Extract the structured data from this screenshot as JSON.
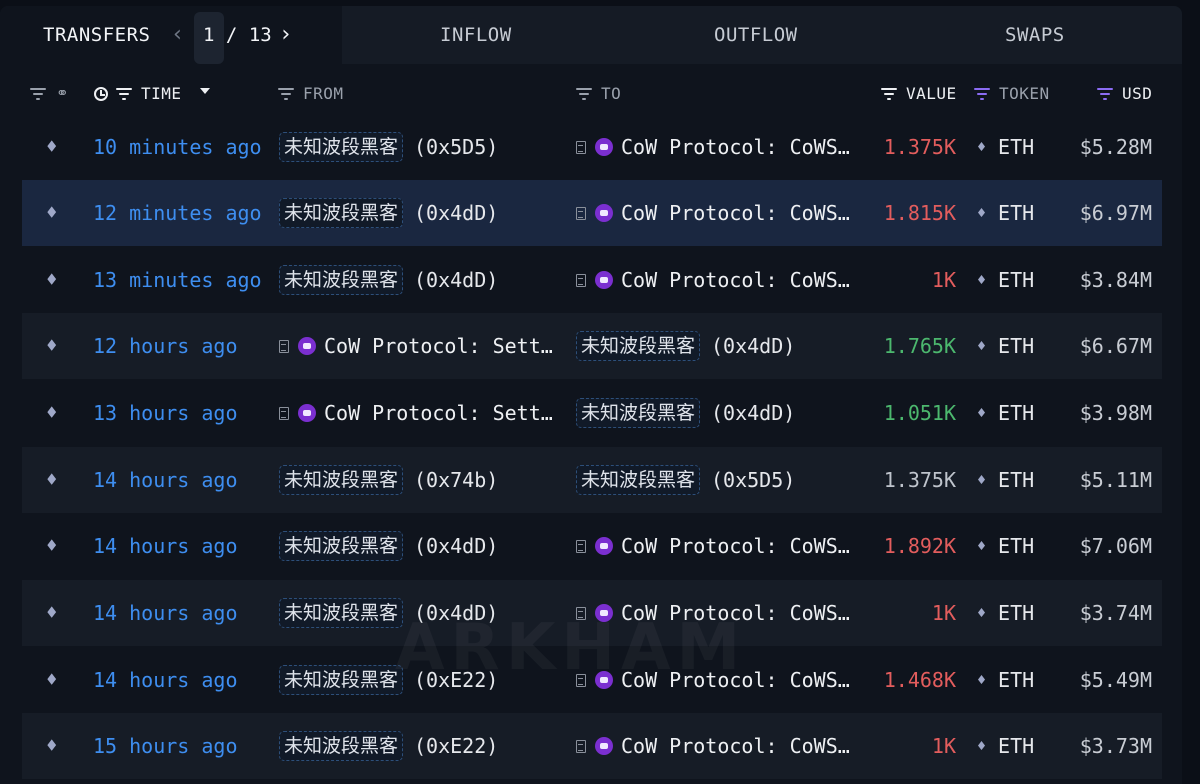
{
  "header": {
    "title": "TRANSFERS",
    "pager": {
      "current": "1",
      "separator": "/",
      "total": "13"
    },
    "tabs": [
      "INFLOW",
      "OUTFLOW",
      "SWAPS"
    ]
  },
  "columns": {
    "time": "TIME",
    "from": "FROM",
    "to": "TO",
    "value": "VALUE",
    "token": "TOKEN",
    "usd": "USD"
  },
  "colors": {
    "accent_blue": "#3e8ef0",
    "value_out": "#e35d5d",
    "value_in": "#4cb86e",
    "value_neutral": "#bfc4cc",
    "filter_active": "#8b6cf3"
  },
  "rows": [
    {
      "time": "10 minutes ago",
      "from": {
        "label": "未知波段黑客",
        "addr": "(0x5D5)"
      },
      "to": {
        "label": "CoW Protocol: CoWS…"
      },
      "value": "1.375K",
      "value_color": "red",
      "token": "ETH",
      "usd": "$5.28M"
    },
    {
      "time": "12 minutes ago",
      "from": {
        "label": "未知波段黑客",
        "addr": "(0x4dD)"
      },
      "to": {
        "label": "CoW Protocol: CoWS…"
      },
      "value": "1.815K",
      "value_color": "red",
      "token": "ETH",
      "usd": "$6.97M"
    },
    {
      "time": "13 minutes ago",
      "from": {
        "label": "未知波段黑客",
        "addr": "(0x4dD)"
      },
      "to": {
        "label": "CoW Protocol: CoWS…"
      },
      "value": "1K",
      "value_color": "red",
      "token": "ETH",
      "usd": "$3.84M"
    },
    {
      "time": "12 hours ago",
      "from": {
        "label": "CoW Protocol: Sett…"
      },
      "to": {
        "label": "未知波段黑客",
        "addr": "(0x4dD)"
      },
      "value": "1.765K",
      "value_color": "green",
      "token": "ETH",
      "usd": "$6.67M"
    },
    {
      "time": "13 hours ago",
      "from": {
        "label": "CoW Protocol: Sett…"
      },
      "to": {
        "label": "未知波段黑客",
        "addr": "(0x4dD)"
      },
      "value": "1.051K",
      "value_color": "green",
      "token": "ETH",
      "usd": "$3.98M"
    },
    {
      "time": "14 hours ago",
      "from": {
        "label": "未知波段黑客",
        "addr": "(0x74b)"
      },
      "to": {
        "label": "未知波段黑客",
        "addr": "(0x5D5)"
      },
      "value": "1.375K",
      "value_color": "grey",
      "token": "ETH",
      "usd": "$5.11M"
    },
    {
      "time": "14 hours ago",
      "from": {
        "label": "未知波段黑客",
        "addr": "(0x4dD)"
      },
      "to": {
        "label": "CoW Protocol: CoWS…"
      },
      "value": "1.892K",
      "value_color": "red",
      "token": "ETH",
      "usd": "$7.06M"
    },
    {
      "time": "14 hours ago",
      "from": {
        "label": "未知波段黑客",
        "addr": "(0x4dD)"
      },
      "to": {
        "label": "CoW Protocol: CoWS…"
      },
      "value": "1K",
      "value_color": "red",
      "token": "ETH",
      "usd": "$3.74M"
    },
    {
      "time": "14 hours ago",
      "from": {
        "label": "未知波段黑客",
        "addr": "(0xE22)"
      },
      "to": {
        "label": "CoW Protocol: CoWS…"
      },
      "value": "1.468K",
      "value_color": "red",
      "token": "ETH",
      "usd": "$5.49M"
    },
    {
      "time": "15 hours ago",
      "from": {
        "label": "未知波段黑客",
        "addr": "(0xE22)"
      },
      "to": {
        "label": "CoW Protocol: CoWS…"
      },
      "value": "1K",
      "value_color": "red",
      "token": "ETH",
      "usd": "$3.73M"
    }
  ],
  "watermark": "ARKHAM"
}
